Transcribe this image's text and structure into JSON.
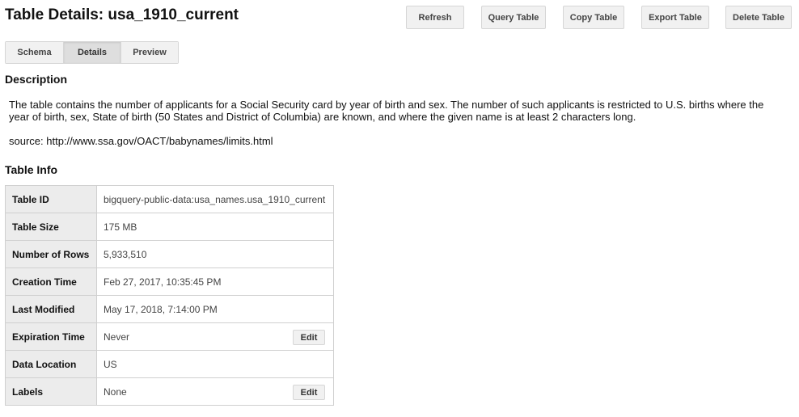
{
  "header": {
    "title": "Table Details: usa_1910_current"
  },
  "actions": {
    "refresh": "Refresh",
    "query_table": "Query Table",
    "copy_table": "Copy Table",
    "export_table": "Export Table",
    "delete_table": "Delete Table"
  },
  "tabs": [
    {
      "label": "Schema",
      "active": false
    },
    {
      "label": "Details",
      "active": true
    },
    {
      "label": "Preview",
      "active": false
    }
  ],
  "description": {
    "heading": "Description",
    "text": "The table contains the number of applicants for a Social Security card by year of birth and sex. The number of such applicants is restricted to U.S. births where the year of birth, sex, State of birth (50 States and District of Columbia) are known, and where the given name is at least 2 characters long.",
    "source": "source: http://www.ssa.gov/OACT/babynames/limits.html"
  },
  "table_info": {
    "heading": "Table Info",
    "edit_label": "Edit",
    "rows": [
      {
        "key": "Table ID",
        "value": "bigquery-public-data:usa_names.usa_1910_current"
      },
      {
        "key": "Table Size",
        "value": "175 MB"
      },
      {
        "key": "Number of Rows",
        "value": "5,933,510"
      },
      {
        "key": "Creation Time",
        "value": "Feb 27, 2017, 10:35:45 PM"
      },
      {
        "key": "Last Modified",
        "value": "May 17, 2018, 7:14:00 PM"
      },
      {
        "key": "Expiration Time",
        "value": "Never"
      },
      {
        "key": "Data Location",
        "value": "US"
      },
      {
        "key": "Labels",
        "value": "None"
      }
    ]
  }
}
